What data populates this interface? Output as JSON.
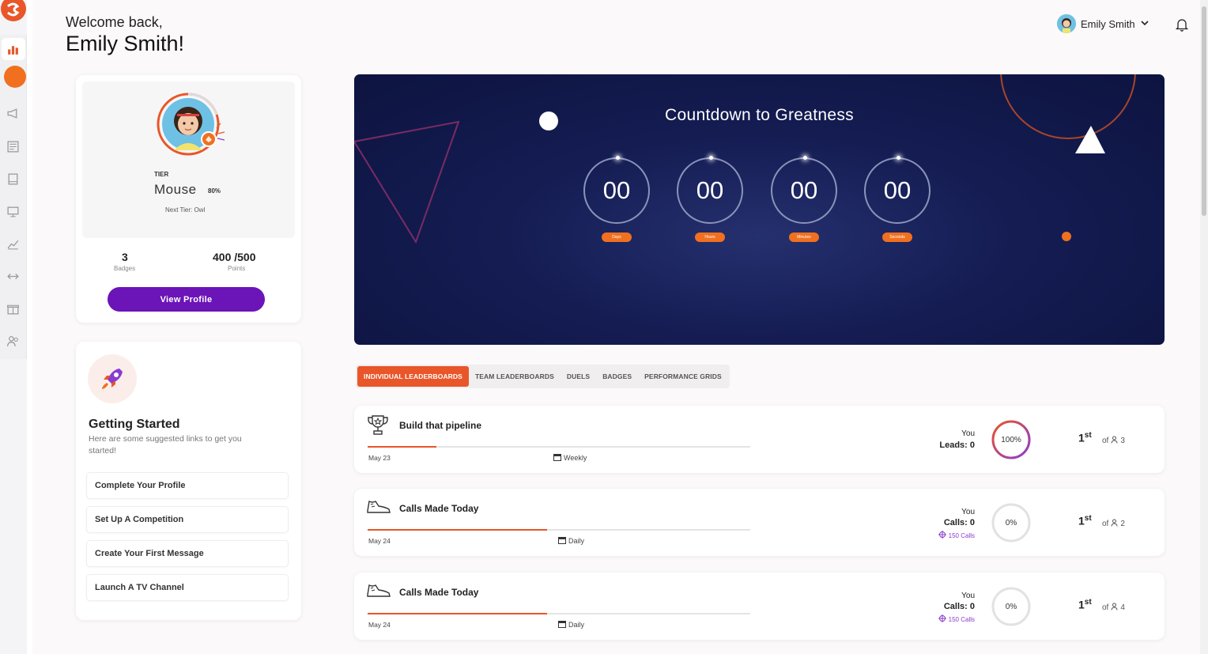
{
  "header": {
    "welcome_line": "Welcome back,",
    "user_name": "Emily Smith!",
    "account_name": "Emily Smith"
  },
  "sidebar": {
    "items": [
      "dashboard-icon",
      "megaphone-icon",
      "newspaper-icon",
      "book-icon",
      "monitor-icon",
      "chart-icon",
      "duel-icon",
      "gift-icon",
      "users-icon"
    ]
  },
  "profile": {
    "tier_label": "TIER",
    "tier_name": "Mouse",
    "tier_progress": "80%",
    "next_tier": "Next Tier: Owl",
    "badges_count": "3",
    "badges_label": "Badges",
    "points_value": "400 /500",
    "points_label": "Points",
    "view_profile": "View Profile"
  },
  "getting_started": {
    "title": "Getting Started",
    "subtitle": "Here are some suggested links to get you started!",
    "links": [
      "Complete Your Profile",
      "Set Up A Competition",
      "Create Your First Message",
      "Launch A TV Channel"
    ]
  },
  "countdown": {
    "title": "Countdown to Greatness",
    "units": [
      {
        "value": "00",
        "label": "Days"
      },
      {
        "value": "00",
        "label": "Hours"
      },
      {
        "value": "00",
        "label": "Minutes"
      },
      {
        "value": "00",
        "label": "Seconds"
      }
    ]
  },
  "tabs": [
    "INDIVIDUAL LEADERBOARDS",
    "TEAM LEADERBOARDS",
    "DUELS",
    "BADGES",
    "PERFORMANCE GRIDS"
  ],
  "leaderboards": [
    {
      "title": "Build that pipeline",
      "icon": "trophy-icon",
      "date": "May 23",
      "period": "Weekly",
      "you": "You",
      "metric": "Leads: 0",
      "target": "",
      "progress_percent": "100%",
      "progress_fill": 0.18,
      "rank": "1",
      "rank_suffix": "st",
      "of_text": "of",
      "participants": "3",
      "ring_color": "#b0308c"
    },
    {
      "title": "Calls Made Today",
      "icon": "sneaker-icon",
      "date": "May 24",
      "period": "Daily",
      "you": "You",
      "metric": "Calls: 0",
      "target": "150 Calls",
      "progress_percent": "0%",
      "progress_fill": 0.47,
      "rank": "1",
      "rank_suffix": "st",
      "of_text": "of",
      "participants": "2",
      "ring_color": "#e0e0e0"
    },
    {
      "title": "Calls Made Today",
      "icon": "sneaker-icon",
      "date": "May 24",
      "period": "Daily",
      "you": "You",
      "metric": "Calls: 0",
      "target": "150 Calls",
      "progress_percent": "0%",
      "progress_fill": 0.47,
      "rank": "1",
      "rank_suffix": "st",
      "of_text": "of",
      "participants": "4",
      "ring_color": "#e0e0e0"
    }
  ],
  "colors": {
    "accent_orange": "#e8562a",
    "brand_purple": "#6b14b8",
    "countdown_bg": "#141c52"
  }
}
